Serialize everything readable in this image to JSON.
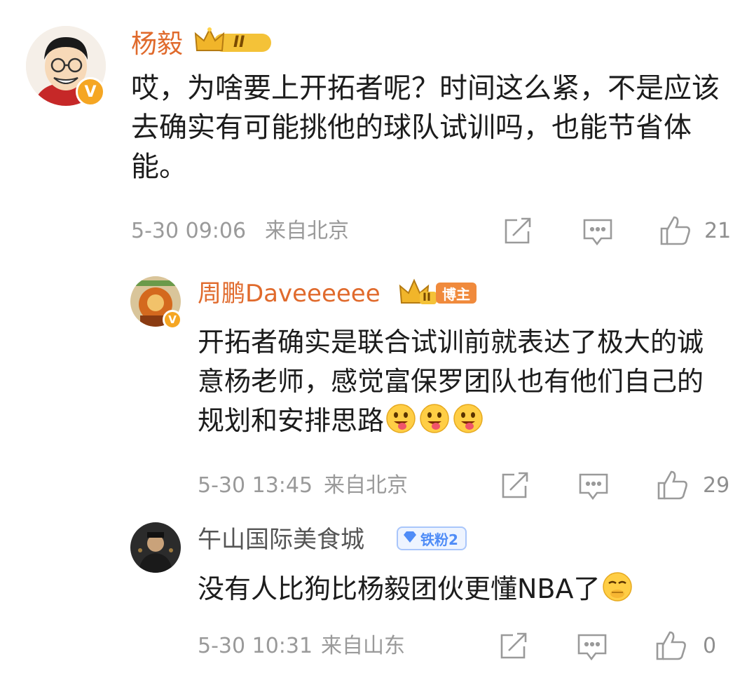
{
  "colors": {
    "username": "#e06a2c",
    "meta": "#9a9a9a",
    "verified": "#f5a623",
    "fan_badge": "#4f8cf7"
  },
  "comment1": {
    "username": "杨毅",
    "level_badge": "II",
    "text": "哎，为啥要上开拓者呢？时间这么紧，不是应该去确实有可能挑他的球队试训吗，也能节省体能。",
    "timestamp": "5-30 09:06",
    "location": "来自北京",
    "like_count": "21",
    "icons": [
      "share-icon",
      "comment-icon",
      "like-icon"
    ]
  },
  "reply1": {
    "username": "周鹏Daveeeeee",
    "level_badge": "II",
    "role_tag": "博主",
    "text": "开拓者确实是联合试训前就表达了极大的诚意杨老师，感觉富保罗团队也有他们自己的规划和安排思路",
    "emojis": [
      "tongue-out-emoji",
      "tongue-out-emoji",
      "tongue-out-emoji"
    ],
    "timestamp": "5-30 13:45",
    "location": "来自北京",
    "like_count": "29"
  },
  "reply2": {
    "username": "午山国际美食城",
    "fan_badge": "铁粉2",
    "text": "没有人比狗比杨毅团伙更懂NBA了",
    "emoji": "laugh-hide-emoji",
    "timestamp": "5-30 10:31",
    "location": "来自山东",
    "like_count": "0"
  }
}
